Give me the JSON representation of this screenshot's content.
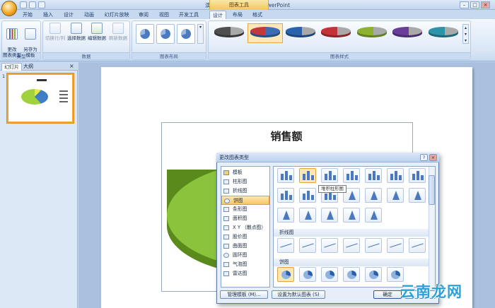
{
  "window": {
    "title": "演示文稿1 - Microsoft PowerPoint",
    "context_tools_label": "图表工具",
    "controls": [
      "–",
      "□",
      "×"
    ]
  },
  "tabs": [
    "开始",
    "插入",
    "设计",
    "动画",
    "幻灯片放映",
    "审阅",
    "视图",
    "开发工具",
    "设计",
    "布局",
    "格式"
  ],
  "active_tab_index": 8,
  "ribbon": {
    "groups": {
      "type": {
        "label": "类型",
        "buttons": [
          "更改\n图表类型",
          "另存为\n模板"
        ]
      },
      "data": {
        "label": "数据",
        "buttons": [
          "切换行/列",
          "选择数据",
          "编辑数据",
          "刷新数据"
        ]
      },
      "layout": {
        "label": "图表布局"
      },
      "styles": {
        "label": "图表样式"
      }
    },
    "style_colors": [
      "#4f4f4f",
      "#3c6cb3",
      "#2b62ac",
      "#c3343a",
      "#8db22f",
      "#6a3d9a",
      "#2c93a8"
    ],
    "selected_style_index": 1
  },
  "left_pane": {
    "tabs": [
      "幻灯片",
      "大纲"
    ],
    "close_glyph": "×",
    "slide_number": "1"
  },
  "slide": {
    "chart_title": "销售额"
  },
  "dialog": {
    "title": "更改图表类型",
    "help_glyph": "?",
    "close_glyph": "×",
    "list_items": [
      "模板",
      "柱形图",
      "折线图",
      "饼图",
      "条形图",
      "面积图",
      "X Y （散点图）",
      "股价图",
      "曲面图",
      "圆环图",
      "气泡图",
      "雷达图"
    ],
    "selected_list_index": 3,
    "sections": [
      "折线图",
      "饼图"
    ],
    "tooltip": "堆积柱形图",
    "buttons": [
      "管理模板 (M)...",
      "设置为默认图表 (S)",
      "确定"
    ]
  },
  "watermark": "云南龙网"
}
